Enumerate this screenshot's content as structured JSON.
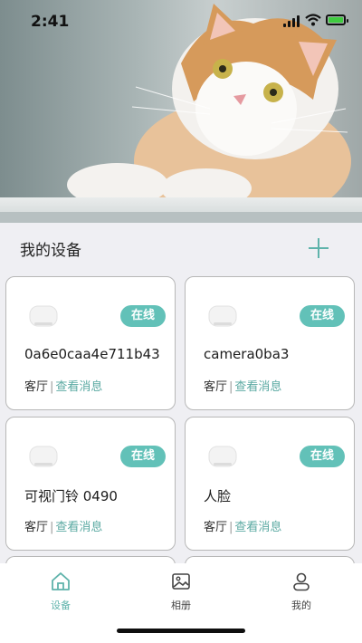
{
  "status_bar": {
    "time": "2:41"
  },
  "header": {
    "title": "我的设备"
  },
  "devices": [
    {
      "status": "在线",
      "name": "0a6e0caa4e711b43",
      "room": "客厅",
      "action": "查看消息"
    },
    {
      "status": "在线",
      "name": "camera0ba3",
      "room": "客厅",
      "action": "查看消息"
    },
    {
      "status": "在线",
      "name": "可视门铃 0490",
      "room": "客厅",
      "action": "查看消息"
    },
    {
      "status": "在线",
      "name": "人脸",
      "room": "客厅",
      "action": "查看消息"
    }
  ],
  "tabs": [
    {
      "label": "设备",
      "icon": "home-icon",
      "active": true
    },
    {
      "label": "相册",
      "icon": "photo-icon",
      "active": false
    },
    {
      "label": "我的",
      "icon": "person-icon",
      "active": false
    }
  ],
  "colors": {
    "accent": "#62c1b8",
    "background": "#efeff3",
    "card": "#ffffff"
  }
}
